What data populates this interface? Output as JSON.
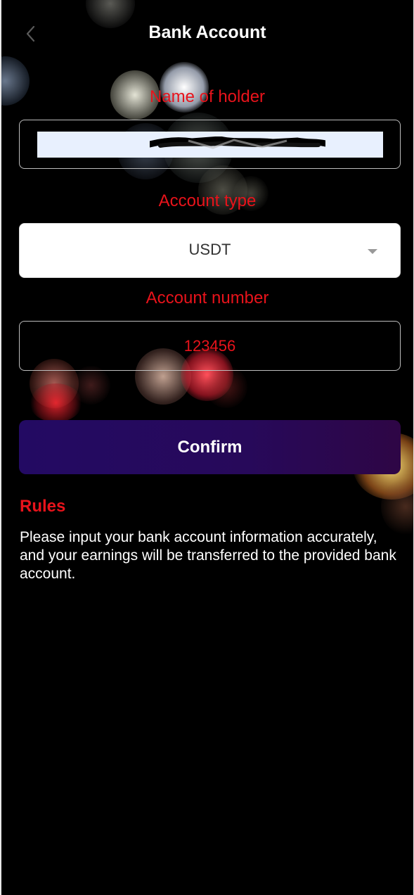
{
  "header": {
    "title": "Bank Account",
    "back_icon": "chevron-left-icon"
  },
  "form": {
    "holder_label": "Name of holder",
    "holder_value": "",
    "type_label": "Account type",
    "type_value": "USDT",
    "type_icon": "caret-down-icon",
    "number_label": "Account number",
    "number_value": "123456",
    "confirm_label": "Confirm"
  },
  "rules": {
    "title": "Rules",
    "text": "Please input your bank account information accurately, and your earnings will be transferred to the provided bank account."
  },
  "colors": {
    "label_red": "#e8131b",
    "button_purple": "#230a63",
    "background": "#000000",
    "autofill_fill": "#e8f0fe"
  }
}
